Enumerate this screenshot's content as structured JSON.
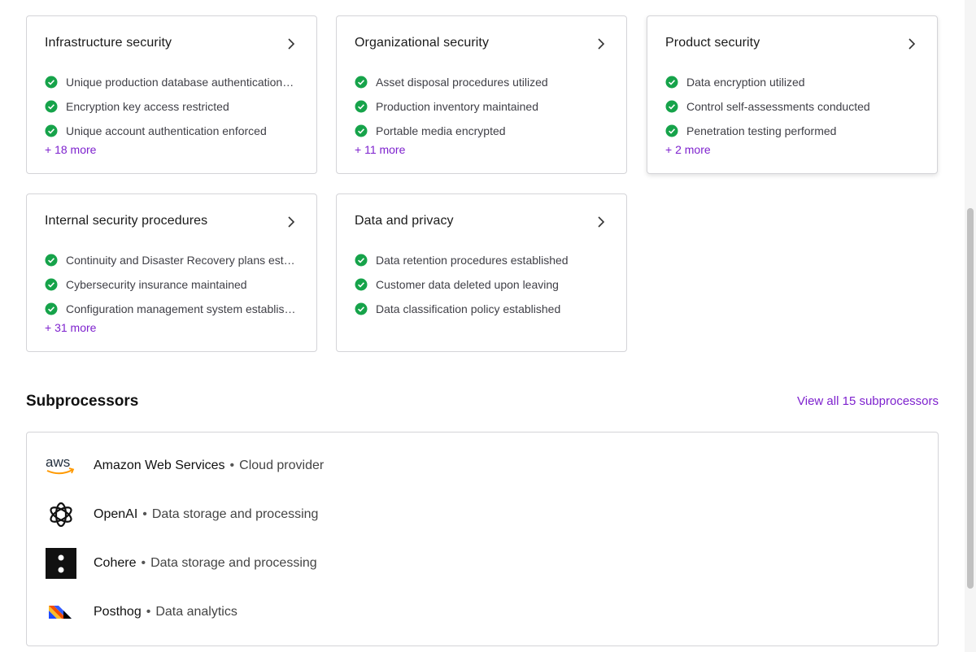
{
  "cards": [
    {
      "title": "Infrastructure security",
      "items": [
        "Unique production database authentication…",
        "Encryption key access restricted",
        "Unique account authentication enforced"
      ],
      "more": "+ 18 more"
    },
    {
      "title": "Organizational security",
      "items": [
        "Asset disposal procedures utilized",
        "Production inventory maintained",
        "Portable media encrypted"
      ],
      "more": "+ 11 more"
    },
    {
      "title": "Product security",
      "items": [
        "Data encryption utilized",
        "Control self-assessments conducted",
        "Penetration testing performed"
      ],
      "more": "+ 2 more"
    },
    {
      "title": "Internal security procedures",
      "items": [
        "Continuity and Disaster Recovery plans est…",
        "Cybersecurity insurance maintained",
        "Configuration management system establis…"
      ],
      "more": "+ 31 more"
    },
    {
      "title": "Data and privacy",
      "items": [
        "Data retention procedures established",
        "Customer data deleted upon leaving",
        "Data classification policy established"
      ]
    }
  ],
  "subprocessors": {
    "heading": "Subprocessors",
    "view_all": "View all 15 subprocessors",
    "separator": "•",
    "items": [
      {
        "name": "Amazon Web Services",
        "description": "Cloud provider",
        "logo_text": "aws",
        "icon": "aws-logo-icon"
      },
      {
        "name": "OpenAI",
        "description": "Data storage and processing",
        "icon": "openai-logo-icon"
      },
      {
        "name": "Cohere",
        "description": "Data storage and processing",
        "icon": "cohere-logo-icon"
      },
      {
        "name": "Posthog",
        "description": "Data analytics",
        "icon": "posthog-logo-icon"
      }
    ]
  },
  "colors": {
    "accent": "#7e22ce",
    "check": "#16a34a",
    "border": "#d4d4d8"
  },
  "icons": {
    "check": "check-circle-icon",
    "chevron": "chevron-right-icon"
  }
}
